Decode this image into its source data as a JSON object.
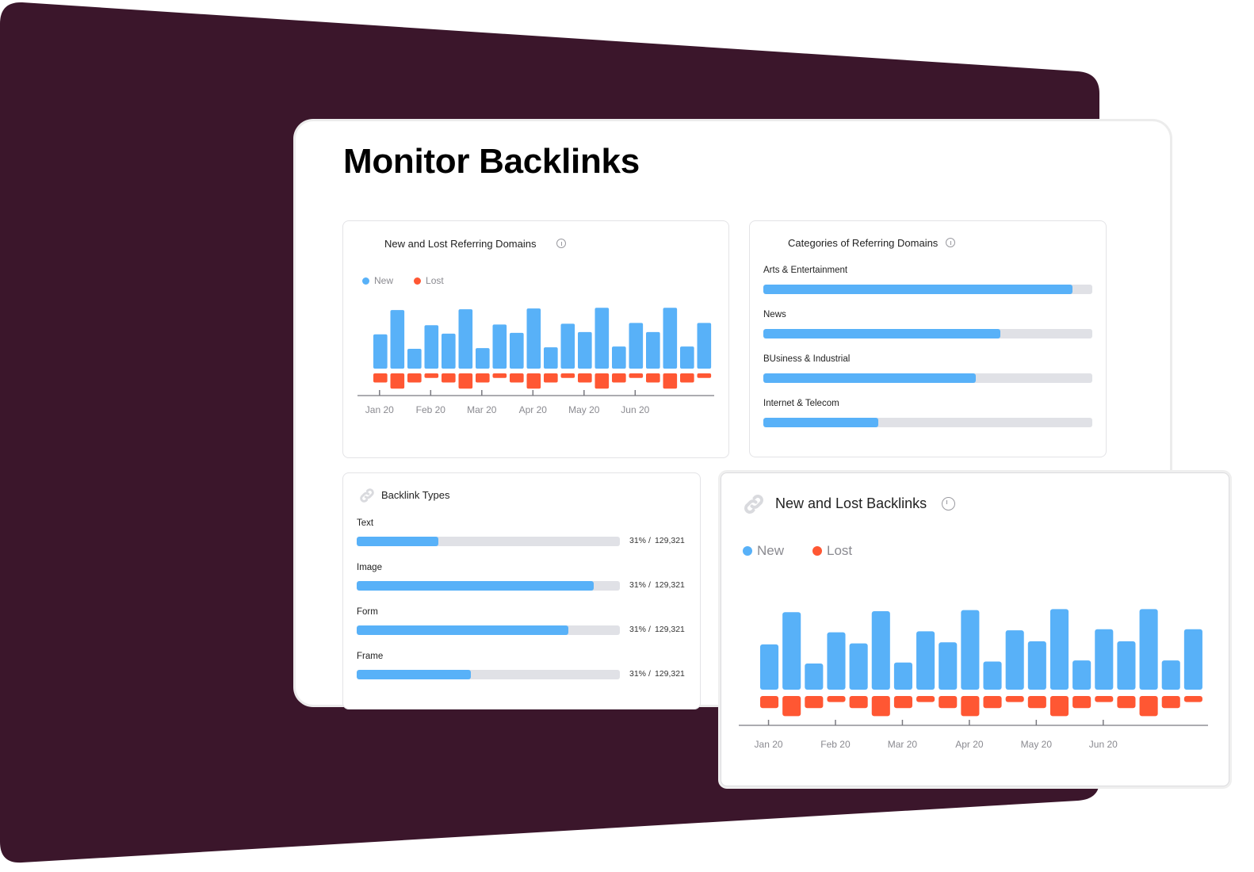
{
  "page": {
    "title": "Monitor Backlinks",
    "colors": {
      "background_shape": "#3b162b",
      "new": "#58b1f8",
      "lost": "#ff5733",
      "track": "#e0e1e6"
    }
  },
  "referring_domains": {
    "title": "New and Lost Referring Domains",
    "legend": [
      {
        "label": "New",
        "color": "#58b1f8"
      },
      {
        "label": "Lost",
        "color": "#ff5733"
      }
    ]
  },
  "categories": {
    "title": "Categories of Referring Domains",
    "items": [
      {
        "label": "Arts & Entertainment",
        "fraction": 0.94
      },
      {
        "label": "News",
        "fraction": 0.72
      },
      {
        "label": "BUsiness & Industrial",
        "fraction": 0.645
      },
      {
        "label": "Internet & Telecom",
        "fraction": 0.35
      }
    ]
  },
  "backlink_types": {
    "title": "Backlink Types",
    "items": [
      {
        "label": "Text",
        "fraction": 0.31,
        "percent": "31%",
        "sep": "/",
        "count": "129,321"
      },
      {
        "label": "Image",
        "fraction": 0.9,
        "percent": "31%",
        "sep": "/",
        "count": "129,321"
      },
      {
        "label": "Form",
        "fraction": 0.805,
        "percent": "31%",
        "sep": "/",
        "count": "129,321"
      },
      {
        "label": "Frame",
        "fraction": 0.435,
        "percent": "31%",
        "sep": "/",
        "count": "129,321"
      }
    ]
  },
  "backlinks": {
    "title": "New and Lost Backlinks",
    "legend": [
      {
        "label": "New",
        "color": "#58b1f8"
      },
      {
        "label": "Lost",
        "color": "#ff5733"
      }
    ]
  },
  "chart_data": [
    {
      "type": "bar",
      "title": "New and Lost Referring Domains",
      "xlabel": "",
      "ylabel": "",
      "x_ticks": [
        "Jan 20",
        "Feb 20",
        "Mar 20",
        "Apr 20",
        "May 20",
        "Jun 20"
      ],
      "x_tick_positions": [
        0.5,
        3.5,
        6.5,
        9.5,
        12.5,
        15.5
      ],
      "series": [
        {
          "name": "New",
          "color": "#58b1f8",
          "values": [
            45,
            77,
            26,
            57,
            46,
            78,
            27,
            58,
            47,
            79,
            28,
            59,
            48,
            80,
            29,
            60,
            48,
            80,
            29,
            60
          ]
        },
        {
          "name": "Lost",
          "color": "#ff5733",
          "values": [
            -12,
            -20,
            -12,
            -6,
            -12,
            -20,
            -12,
            -6,
            -12,
            -20,
            -12,
            -6,
            -12,
            -20,
            -12,
            -6,
            -12,
            -20,
            -12,
            -6
          ]
        }
      ],
      "ylim": [
        -25,
        85
      ],
      "grid": false,
      "legend": "top-left"
    },
    {
      "type": "bar",
      "title": "New and Lost Backlinks",
      "xlabel": "",
      "ylabel": "",
      "x_ticks": [
        "Jan 20",
        "Feb 20",
        "Mar 20",
        "Apr 20",
        "May 20",
        "Jun 20"
      ],
      "x_tick_positions": [
        0.5,
        3.5,
        6.5,
        9.5,
        12.5,
        15.5
      ],
      "series": [
        {
          "name": "New",
          "color": "#58b1f8",
          "values": [
            45,
            77,
            26,
            57,
            46,
            78,
            27,
            58,
            47,
            79,
            28,
            59,
            48,
            80,
            29,
            60,
            48,
            80,
            29,
            60
          ]
        },
        {
          "name": "Lost",
          "color": "#ff5733",
          "values": [
            -12,
            -20,
            -12,
            -6,
            -12,
            -20,
            -12,
            -6,
            -12,
            -20,
            -12,
            -6,
            -12,
            -20,
            -12,
            -6,
            -12,
            -20,
            -12,
            -6
          ]
        }
      ],
      "ylim": [
        -25,
        85
      ],
      "grid": false,
      "legend": "top-left"
    }
  ]
}
